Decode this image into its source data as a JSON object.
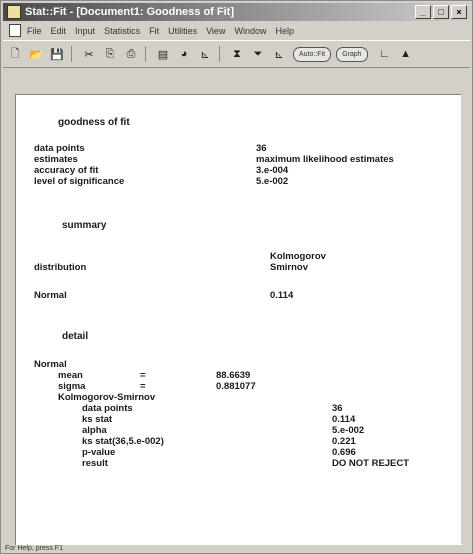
{
  "window": {
    "title": "Stat::Fit - [Document1: Goodness of Fit]",
    "menu": [
      "File",
      "Edit",
      "Input",
      "Statistics",
      "Fit",
      "Utilities",
      "View",
      "Window",
      "Help"
    ],
    "toolbar_pills": [
      "Auto::Fit",
      "Graph"
    ]
  },
  "report": {
    "gof_heading": "goodness of fit",
    "gof_rows": [
      {
        "label": "data points",
        "value": "36"
      },
      {
        "label": "estimates",
        "value": "maximum likelihood estimates"
      },
      {
        "label": "accuracy of fit",
        "value": "3.e-004"
      },
      {
        "label": "level of significance",
        "value": "5.e-002"
      }
    ],
    "summary_heading": "summary",
    "summary_col1": "distribution",
    "summary_col2_line1": "Kolmogorov",
    "summary_col2_line2": "Smirnov",
    "summary_row": {
      "dist": "Normal",
      "value": "0.114"
    },
    "detail_heading": "detail",
    "detail_dist": "Normal",
    "params": [
      {
        "label": "mean",
        "eq": "=",
        "value": "88.6639"
      },
      {
        "label": "sigma",
        "eq": "=",
        "value": "0.881077"
      }
    ],
    "test_name": "Kolmogorov-Smirnov",
    "test_rows": [
      {
        "label": "data points",
        "value": "36"
      },
      {
        "label": "ks stat",
        "value": "0.114"
      },
      {
        "label": "alpha",
        "value": "5.e-002"
      },
      {
        "label": "ks stat(36,5.e-002)",
        "value": "0.221"
      },
      {
        "label": "p-value",
        "value": "0.696"
      },
      {
        "label": "result",
        "value": "DO NOT REJECT"
      }
    ]
  },
  "status": {
    "text": "For Help, press F1"
  }
}
